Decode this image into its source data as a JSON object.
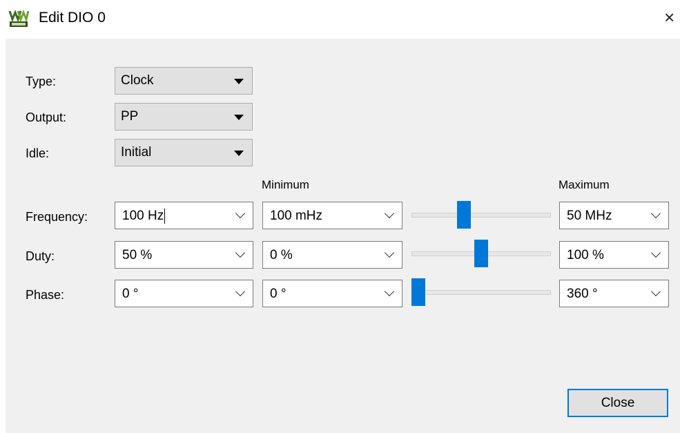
{
  "window": {
    "title": "Edit DIO 0",
    "icon": "waveforms-app-icon"
  },
  "settings": {
    "type": {
      "label": "Type:",
      "value": "Clock"
    },
    "output": {
      "label": "Output:",
      "value": "PP"
    },
    "idle": {
      "label": "Idle:",
      "value": "Initial"
    }
  },
  "columns": {
    "minimum": "Minimum",
    "maximum": "Maximum"
  },
  "params": {
    "frequency": {
      "label": "Frequency:",
      "value": "100 Hz",
      "minimum": "100 mHz",
      "maximum": "50 MHz",
      "slider_level": 0.36
    },
    "duty": {
      "label": "Duty:",
      "value": "50 %",
      "minimum": "0 %",
      "maximum": "100 %",
      "slider_level": 0.5
    },
    "phase": {
      "label": "Phase:",
      "value": "0 °",
      "minimum": "0 °",
      "maximum": "360 °",
      "slider_level": 0.0
    }
  },
  "buttons": {
    "close": "Close"
  },
  "colors": {
    "accent": "#0078d7",
    "client_bg": "#f0f0f0",
    "combo_bg": "#e1e1e1"
  }
}
